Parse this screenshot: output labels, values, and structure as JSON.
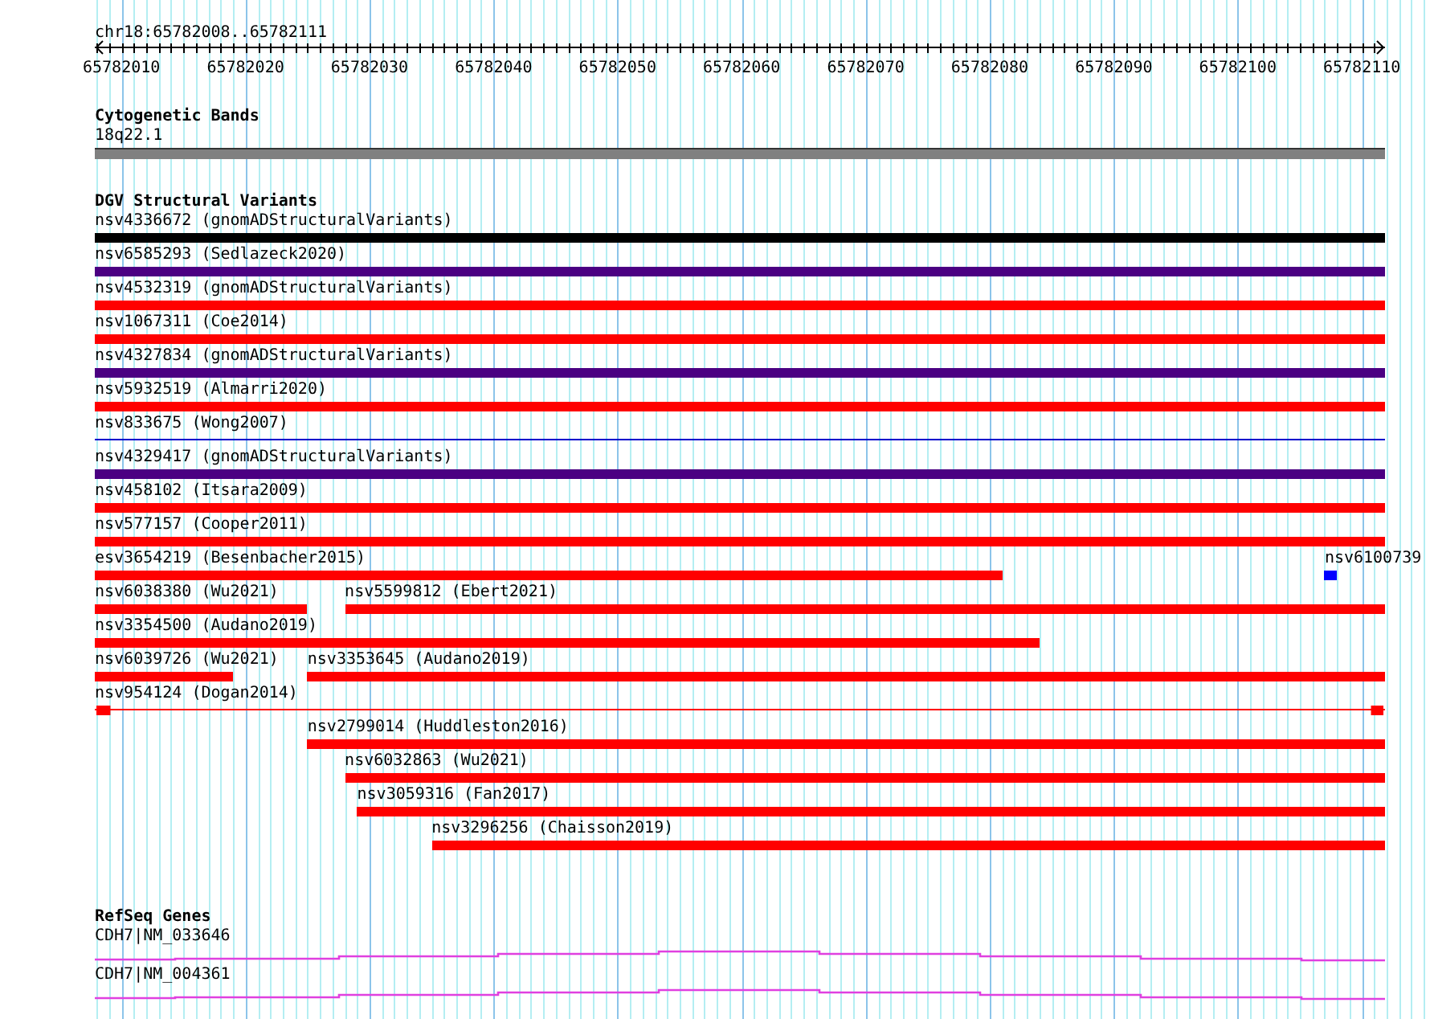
{
  "ruler": {
    "locus": "chr18:65782008..65782111",
    "ticks": [
      "65782010",
      "65782020",
      "65782030",
      "65782040",
      "65782050",
      "65782060",
      "65782070",
      "65782080",
      "65782090",
      "65782100",
      "65782110"
    ]
  },
  "cytogenetic_bands": {
    "title": "Cytogenetic Bands",
    "band": "18q22.1"
  },
  "dgv_structural_variants": {
    "title": "DGV Structural Variants",
    "lanes": [
      {
        "features": [
          {
            "label": "nsv4336672 (gnomADStructuralVariants)",
            "kind": "bar",
            "color": "#000000"
          }
        ]
      },
      {
        "features": [
          {
            "label": "nsv6585293 (Sedlazeck2020)",
            "kind": "bar",
            "color": "#4b0082"
          }
        ]
      },
      {
        "features": [
          {
            "label": "nsv4532319 (gnomADStructuralVariants)",
            "kind": "bar",
            "color": "#ff0000"
          }
        ]
      },
      {
        "features": [
          {
            "label": "nsv1067311 (Coe2014)",
            "kind": "bar",
            "color": "#ff0000"
          }
        ]
      },
      {
        "features": [
          {
            "label": "nsv4327834 (gnomADStructuralVariants)",
            "kind": "bar",
            "color": "#4b0082"
          }
        ]
      },
      {
        "features": [
          {
            "label": "nsv5932519 (Almarri2020)",
            "kind": "bar",
            "color": "#ff0000"
          }
        ]
      },
      {
        "features": [
          {
            "label": "nsv833675 (Wong2007)",
            "kind": "line",
            "color": "#0000cc"
          }
        ]
      },
      {
        "features": [
          {
            "label": "nsv4329417 (gnomADStructuralVariants)",
            "kind": "bar",
            "color": "#4b0082"
          }
        ]
      },
      {
        "features": [
          {
            "label": "nsv458102 (Itsara2009)",
            "kind": "bar",
            "color": "#ff0000"
          }
        ]
      },
      {
        "features": [
          {
            "label": "nsv577157 (Cooper2011)",
            "kind": "bar",
            "color": "#ff0000"
          }
        ]
      },
      {
        "features": [
          {
            "label": "esv3654219 (Besenbacher2015)",
            "kind": "bar",
            "color": "#ff0000"
          },
          {
            "label": "nsv6100739",
            "kind": "bar",
            "color": "#0000ff"
          }
        ]
      },
      {
        "features": [
          {
            "label": "nsv6038380 (Wu2021)",
            "kind": "bar",
            "color": "#ff0000"
          },
          {
            "label": "nsv5599812 (Ebert2021)",
            "kind": "bar",
            "color": "#ff0000"
          }
        ]
      },
      {
        "features": [
          {
            "label": "nsv3354500 (Audano2019)",
            "kind": "bar",
            "color": "#ff0000"
          }
        ]
      },
      {
        "features": [
          {
            "label": "nsv6039726 (Wu2021)",
            "kind": "bar",
            "color": "#ff0000"
          },
          {
            "label": "nsv3353645 (Audano2019)",
            "kind": "bar",
            "color": "#ff0000"
          }
        ]
      },
      {
        "features": [
          {
            "label": "nsv954124 (Dogan2014)",
            "kind": "split",
            "color": "#ff0000"
          }
        ]
      },
      {
        "features": [
          {
            "label": "nsv2799014 (Huddleston2016)",
            "kind": "bar",
            "color": "#ff0000"
          }
        ]
      },
      {
        "features": [
          {
            "label": "nsv6032863 (Wu2021)",
            "kind": "bar",
            "color": "#ff0000"
          }
        ]
      },
      {
        "features": [
          {
            "label": "nsv3059316 (Fan2017)",
            "kind": "bar",
            "color": "#ff0000"
          }
        ]
      },
      {
        "features": [
          {
            "label": "nsv3296256 (Chaisson2019)",
            "kind": "bar",
            "color": "#ff0000"
          }
        ]
      }
    ]
  },
  "refseq_genes": {
    "title": "RefSeq Genes",
    "genes": [
      {
        "label": "CDH7|NM_033646"
      },
      {
        "label": "CDH7|NM_004361"
      }
    ]
  }
}
